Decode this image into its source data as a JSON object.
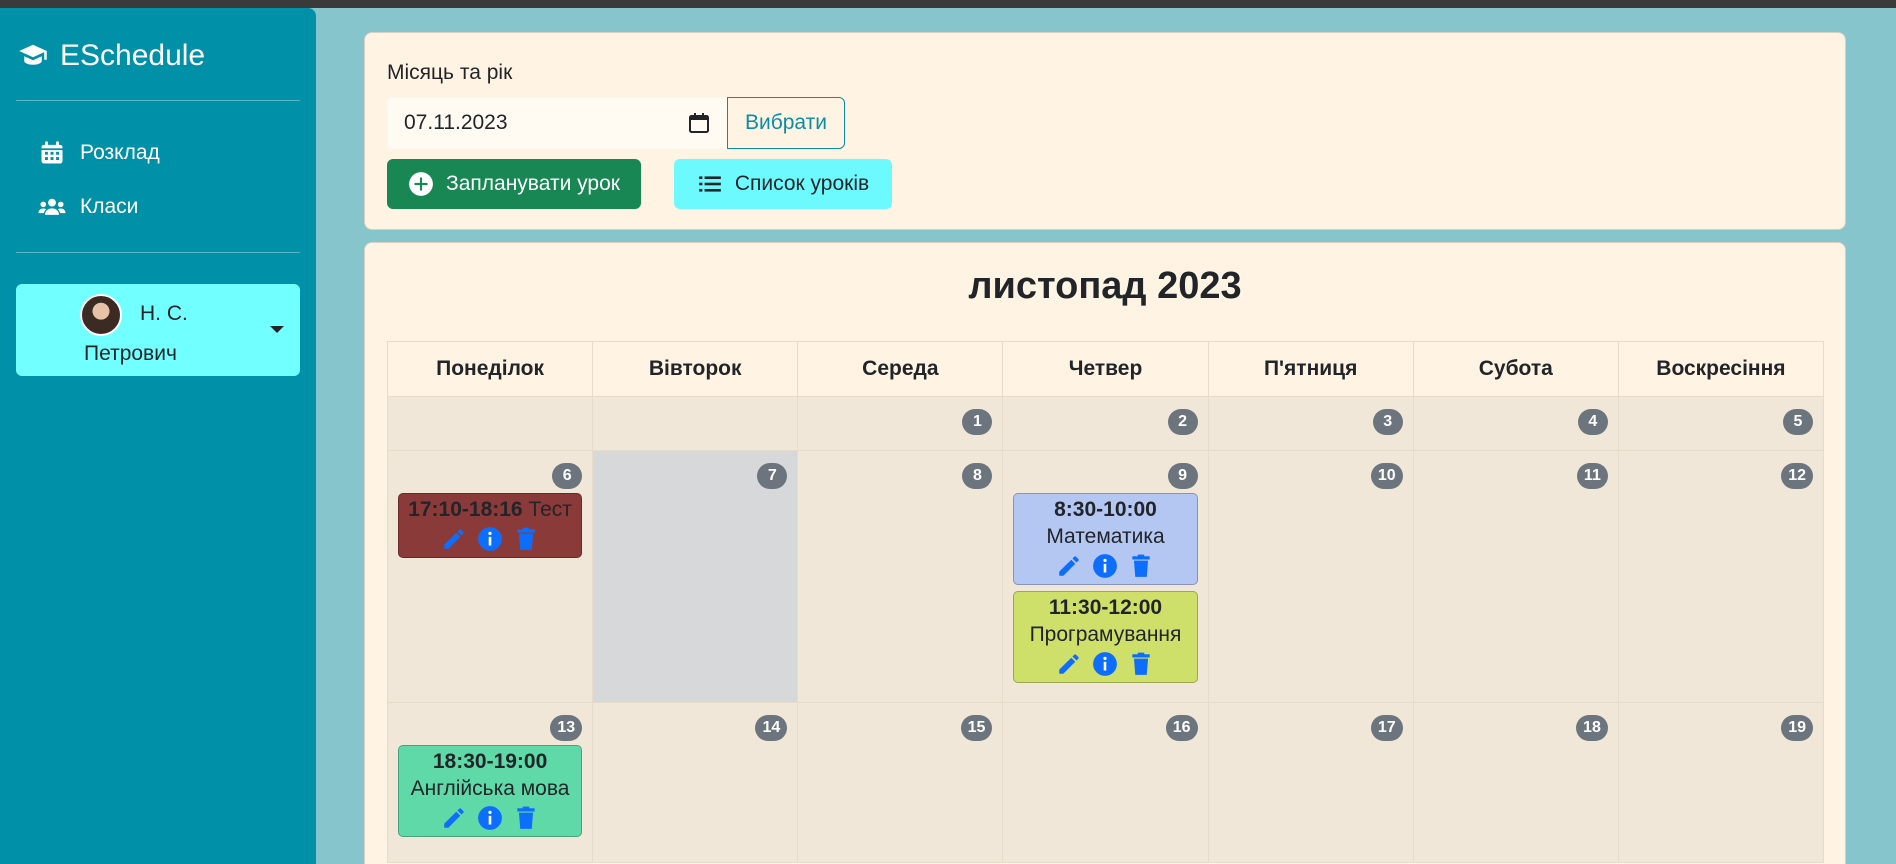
{
  "app": {
    "brand": "ESchedule",
    "brand_icon": "graduation-cap-icon"
  },
  "sidebar": {
    "items": [
      {
        "label": "Розклад",
        "icon": "calendar-icon"
      },
      {
        "label": "Класи",
        "icon": "users-icon"
      }
    ],
    "user": {
      "name_line1": "Н. С.",
      "name_line2": "Петрович"
    }
  },
  "filter": {
    "label": "Місяць та рік",
    "date_value": "07.11.2023",
    "choose_label": "Вибрати",
    "plan_label": "Запланувати урок",
    "list_label": "Список уроків"
  },
  "calendar": {
    "title": "листопад 2023",
    "weekdays": [
      "Понеділок",
      "Вівторок",
      "Середа",
      "Четвер",
      "П'ятниця",
      "Субота",
      "Воскресіння"
    ],
    "today": 7,
    "weeks": [
      [
        null,
        null,
        1,
        2,
        3,
        4,
        5
      ],
      [
        6,
        7,
        8,
        9,
        10,
        11,
        12
      ],
      [
        13,
        14,
        15,
        16,
        17,
        18,
        19
      ]
    ],
    "events": [
      {
        "day": 6,
        "time": "17:10-18:16",
        "title": "Тест",
        "inline": true,
        "color": "#8b3a3a"
      },
      {
        "day": 9,
        "time": "8:30-10:00",
        "title": "Математика",
        "inline": false,
        "color": "#b4c6f2"
      },
      {
        "day": 9,
        "time": "11:30-12:00",
        "title": "Програмування",
        "inline": false,
        "color": "#cfe06a"
      },
      {
        "day": 13,
        "time": "18:30-19:00",
        "title": "Англійська мова",
        "inline": false,
        "color": "#5fd9a7"
      }
    ]
  }
}
